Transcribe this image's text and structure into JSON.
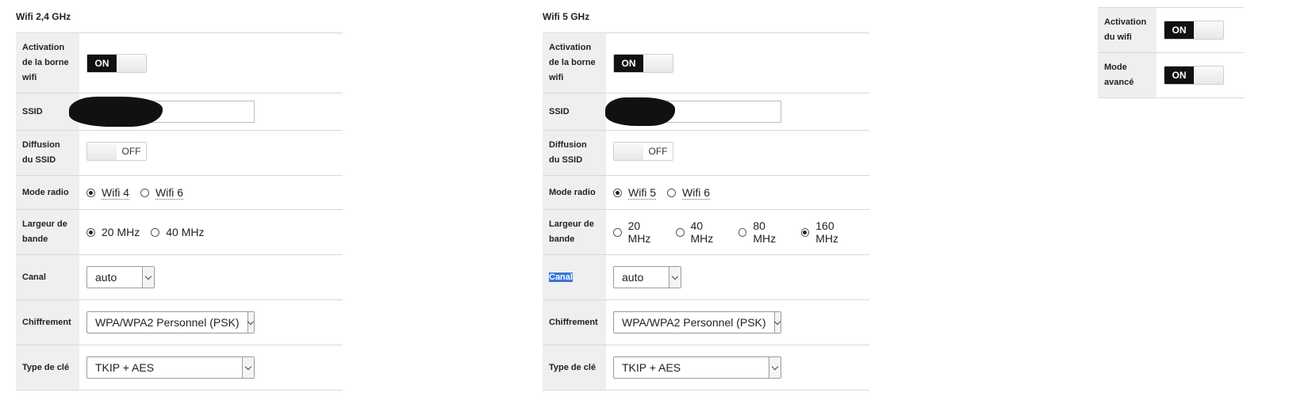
{
  "wifi24": {
    "title": "Wifi 2,4 GHz",
    "activation": {
      "label": "Activation de la borne wifi",
      "state": "ON"
    },
    "ssid": {
      "label": "SSID",
      "value": ""
    },
    "broadcast": {
      "label": "Diffusion du SSID",
      "state": "OFF"
    },
    "mode": {
      "label": "Mode radio",
      "options": [
        "Wifi 4",
        "Wifi 6"
      ],
      "selected": "Wifi 4"
    },
    "bandwidth": {
      "label": "Largeur de bande",
      "options": [
        "20 MHz",
        "40 MHz"
      ],
      "selected": "20 MHz"
    },
    "channel": {
      "label": "Canal",
      "value": "auto"
    },
    "encryption": {
      "label": "Chiffrement",
      "value": "WPA/WPA2 Personnel (PSK)"
    },
    "keytype": {
      "label": "Type de clé",
      "value": "TKIP + AES"
    }
  },
  "wifi5": {
    "title": "Wifi 5 GHz",
    "activation": {
      "label": "Activation de la borne wifi",
      "state": "ON"
    },
    "ssid": {
      "label": "SSID",
      "value": ""
    },
    "broadcast": {
      "label": "Diffusion du SSID",
      "state": "OFF"
    },
    "mode": {
      "label": "Mode radio",
      "options": [
        "Wifi 5",
        "Wifi 6"
      ],
      "selected": "Wifi 5"
    },
    "bandwidth": {
      "label": "Largeur de bande",
      "options": [
        "20 MHz",
        "40 MHz",
        "80 MHz",
        "160 MHz"
      ],
      "selected": "160 MHz"
    },
    "channel": {
      "label": "Canal",
      "value": "auto"
    },
    "encryption": {
      "label": "Chiffrement",
      "value": "WPA/WPA2 Personnel (PSK)"
    },
    "keytype": {
      "label": "Type de clé",
      "value": "TKIP + AES"
    }
  },
  "global": {
    "wifi_activation": {
      "label": "Activation du wifi",
      "state": "ON"
    },
    "advanced_mode": {
      "label": "Mode avancé",
      "state": "ON"
    }
  },
  "colors": {
    "toggle_on": "#111111",
    "label_bg": "#efefef",
    "selection_highlight": "#3875d7"
  }
}
